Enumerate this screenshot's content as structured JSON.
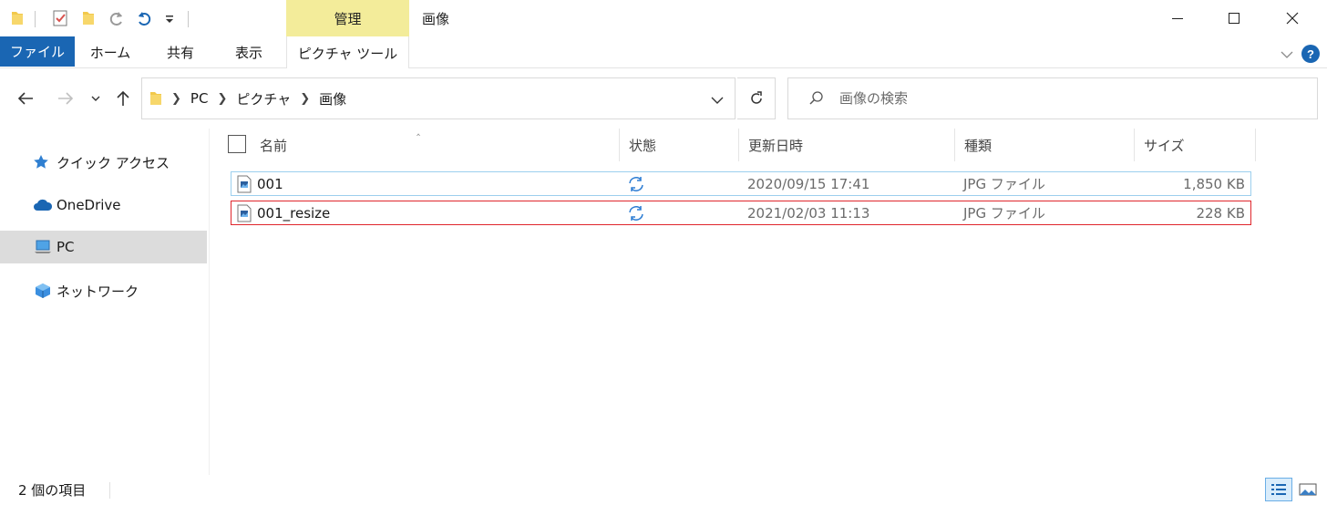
{
  "window": {
    "title": "画像",
    "contextual_tab": "管理"
  },
  "ribbon": {
    "tabs": [
      "ファイル",
      "ホーム",
      "共有",
      "表示",
      "ピクチャ ツール"
    ],
    "help_label": "?"
  },
  "address": {
    "breadcrumbs": [
      "PC",
      "ピクチャ",
      "画像"
    ]
  },
  "search": {
    "placeholder": "画像の検索"
  },
  "nav": {
    "items": [
      "クイック アクセス",
      "OneDrive",
      "PC",
      "ネットワーク"
    ]
  },
  "columns": {
    "name": "名前",
    "status": "状態",
    "modified": "更新日時",
    "type": "種類",
    "size": "サイズ"
  },
  "files": [
    {
      "name": "001",
      "modified": "2020/09/15 17:41",
      "type": "JPG ファイル",
      "size": "1,850 KB"
    },
    {
      "name": "001_resize",
      "modified": "2021/02/03 11:13",
      "type": "JPG ファイル",
      "size": "228 KB"
    }
  ],
  "statusbar": {
    "item_count": "2 個の項目"
  },
  "colors": {
    "accent": "#1a66b3",
    "manage_tab": "#f3ec9a",
    "selection_border": "#9ccfee",
    "highlight_border": "#e0262c",
    "sync_icon": "#2b7cd3",
    "nav_selected": "#dcdcdc"
  }
}
